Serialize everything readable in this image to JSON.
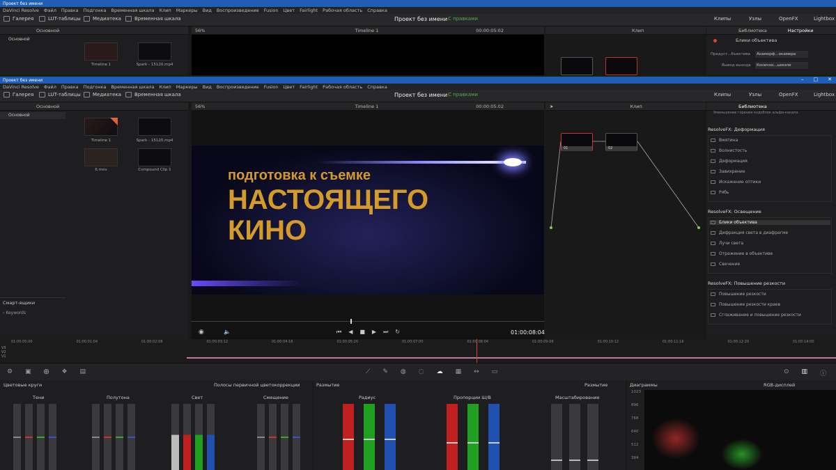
{
  "window": {
    "title_top": "Проект без имени",
    "title_main": "Проект без имени"
  },
  "menu": [
    "DaVinci Resolve",
    "Файл",
    "Правка",
    "Подгонка",
    "Временная шкала",
    "Клип",
    "Маркеры",
    "Вид",
    "Воспроизведение",
    "Fusion",
    "Цвет",
    "Fairlight",
    "Рабочая область",
    "Справка"
  ],
  "toolbar": {
    "gallery": "Галерея",
    "lut": "LUT-таблицы",
    "media": "Медиатека",
    "timeline": "Временная шкала",
    "project": "Проект без имени",
    "status": "С правками",
    "clips": "Клипы",
    "nodes": "Узлы",
    "openfx": "OpenFX",
    "lightbox": "Lightbox"
  },
  "viewer": {
    "zoom": "56%",
    "timeline_name": "Timeline 1",
    "tc_top": "00:00:05:02",
    "timecode": "01:00:08:04",
    "clip_mode": "Клип"
  },
  "media": {
    "bin": "Основной",
    "clips": [
      "Timeline 1",
      "Spark - 15120.mp4",
      "6.mov",
      "Compound Clip 1"
    ],
    "smart": "Смарт-ящики",
    "keywords": "Keywords"
  },
  "fx": {
    "tab_library": "Библиотека",
    "tab_settings": "Настройки",
    "selected": "Блики объектива",
    "preset_label": "Предуст...бъектива",
    "preset_val": "Анаморф...окамера",
    "out_label": "Вывод выхода",
    "out_val": "Конечно...ьекэле",
    "top_partial": "Уменьшение горения кодоблок альфа-канала",
    "sections": [
      {
        "title": "ResolveFX: Деформация",
        "items": [
          "Вмятина",
          "Волнистость",
          "Деформация",
          "Завихрение",
          "Искажение оптики",
          "Рябь"
        ]
      },
      {
        "title": "ResolveFX: Освещение",
        "items": [
          "Блики объектива",
          "Дифракция света в диафрагме",
          "Лучи света",
          "Отражение в объективе",
          "Свечение"
        ]
      },
      {
        "title": "ResolveFX: Повышение резкости",
        "items": [
          "Повышение резкости",
          "Повышение резкости краев",
          "Сглаживание и повышение резкости"
        ]
      }
    ]
  },
  "ruler": [
    "01:00:00:00",
    "01:00:01:04",
    "01:00:02:08",
    "01:00:03:12",
    "01:00:04:16",
    "01:00:05:20",
    "01:00:07:00",
    "01:00:08:04",
    "01:00:09:08",
    "01:00:10:12",
    "01:00:11:16",
    "01:00:12:20",
    "01:00:14:00"
  ],
  "tracks": [
    "V3",
    "V2",
    "V1"
  ],
  "color": {
    "wheels_title": "Цветовые круги",
    "mode": "Полосы первичной цветокоррекции",
    "groups": [
      "Тени",
      "Полутона",
      "Свет",
      "Смещение"
    ],
    "blur_title": "Размытие",
    "blur_mode": "Размытие",
    "blur_groups": [
      "Радиус",
      "Пропорции Ш/В",
      "Масштабирование"
    ],
    "scopes_title": "Диаграммы",
    "scopes_mode": "RGB-дисплей",
    "scale": [
      "1023",
      "896",
      "768",
      "640",
      "512",
      "384"
    ]
  },
  "title_text": [
    "подготовка к съемке",
    "НАСТОЯЩЕГО",
    "КИНО"
  ],
  "colors": {
    "accent": "#e0403c",
    "blue_bar": "#1e5fb4",
    "text_gold": "#d49a2a"
  }
}
